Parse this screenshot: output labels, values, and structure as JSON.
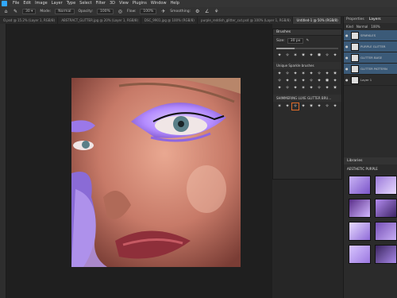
{
  "menu": [
    "File",
    "Edit",
    "Image",
    "Layer",
    "Type",
    "Select",
    "Filter",
    "3D",
    "View",
    "Plugins",
    "Window",
    "Help"
  ],
  "options": {
    "mode_label": "Mode:",
    "mode_value": "Normal",
    "opacity_label": "Opacity:",
    "opacity_value": "100%",
    "flow_label": "Flow:",
    "flow_value": "100%",
    "smoothing_label": "Smoothing:"
  },
  "tabs": [
    "O.psd @ 15.2% (Layer 1, RGB/8)",
    "ABSTRACT_GLITTER.jpg @ 20% (Layer 1, RGB/8)",
    "DSC_9901.jpg @ 100% (RGB/8)",
    "purple_reddish_glitter_cut.psd @ 100% (Layer 1, RGB/8)",
    "Untitled-1 @ 50% (RGB/8)"
  ],
  "active_tab": 4,
  "brush": {
    "title": "Brushes",
    "size": "30 px",
    "size_fill": 0.3,
    "group1": "Unique Sparkle brushes",
    "group2": "SHIMMERING LUXE GLITTER BRU..."
  },
  "layers": {
    "tabs": [
      "Properties",
      "Layers"
    ],
    "kind": "Kind",
    "blend": "Normal",
    "opacity": "100%",
    "items": [
      {
        "name": "SPARKLES",
        "visible": true,
        "selected": true
      },
      {
        "name": "PURPLE GLITTER",
        "visible": true,
        "selected": true
      },
      {
        "name": "GLITTER BASE",
        "visible": true,
        "selected": true
      },
      {
        "name": "GLITTER PATTERN",
        "visible": true,
        "selected": true
      },
      {
        "name": "Layer 1",
        "visible": true,
        "selected": false
      }
    ]
  },
  "libraries": {
    "title": "Libraries",
    "name": "AESTHETIC PURPLE"
  },
  "colors": {
    "accent": "#31a8ff",
    "glitter": "#b48cff",
    "selection": "#3b5a78"
  }
}
